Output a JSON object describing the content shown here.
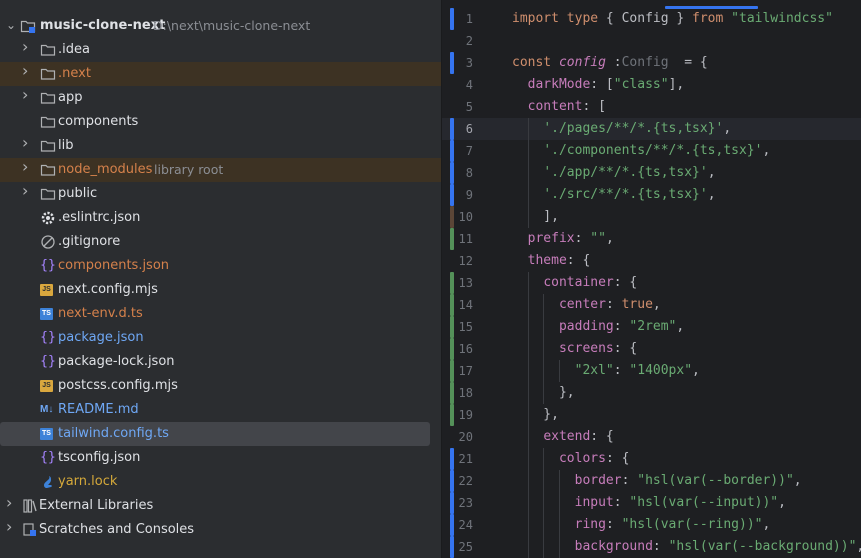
{
  "project_tree": {
    "root": {
      "name": "music-clone-next",
      "path": "D:\\next\\music-clone-next"
    },
    "items": [
      {
        "label": ".idea",
        "type": "folder",
        "expandable": true
      },
      {
        "label": ".next",
        "type": "folder",
        "expandable": true,
        "excluded": true
      },
      {
        "label": "app",
        "type": "folder",
        "expandable": true
      },
      {
        "label": "components",
        "type": "folder",
        "expandable": false
      },
      {
        "label": "lib",
        "type": "folder",
        "expandable": true
      },
      {
        "label": "node_modules",
        "type": "folder",
        "expandable": true,
        "excluded": true,
        "hint": "library root"
      },
      {
        "label": "public",
        "type": "folder",
        "expandable": true
      },
      {
        "label": ".eslintrc.json",
        "type": "eslint"
      },
      {
        "label": ".gitignore",
        "type": "ignore"
      },
      {
        "label": "components.json",
        "type": "json",
        "color": "#d5814b"
      },
      {
        "label": "next.config.mjs",
        "type": "js"
      },
      {
        "label": "next-env.d.ts",
        "type": "ts",
        "color": "#d5814b"
      },
      {
        "label": "package.json",
        "type": "json",
        "color": "#6fa8f5"
      },
      {
        "label": "package-lock.json",
        "type": "json"
      },
      {
        "label": "postcss.config.mjs",
        "type": "js"
      },
      {
        "label": "README.md",
        "type": "md",
        "color": "#6fa8f5"
      },
      {
        "label": "tailwind.config.ts",
        "type": "ts",
        "color": "#6fa8f5",
        "selected": true
      },
      {
        "label": "tsconfig.json",
        "type": "json"
      },
      {
        "label": "yarn.lock",
        "type": "yarn",
        "color": "#d5a93a"
      }
    ],
    "footer": [
      {
        "label": "External Libraries",
        "icon": "library-icon"
      },
      {
        "label": "Scratches and Consoles",
        "icon": "scratch-icon"
      }
    ]
  },
  "editor": {
    "file": "tailwind.config.ts",
    "current_line": 6,
    "lines": [
      {
        "n": "1",
        "mark": "blue",
        "code": "import type { Config } from \"tailwindcss\""
      },
      {
        "n": "2",
        "mark": "",
        "code": ""
      },
      {
        "n": "3",
        "mark": "blue",
        "code": "const config :  = {",
        "hint": "Config"
      },
      {
        "n": "4",
        "mark": "",
        "code": "  darkMode: [\"class\"],"
      },
      {
        "n": "5",
        "mark": "",
        "code": "  content: ["
      },
      {
        "n": "6",
        "mark": "blue",
        "code": "    './pages/**/*.{ts,tsx}',"
      },
      {
        "n": "7",
        "mark": "blue",
        "code": "    './components/**/*.{ts,tsx}',"
      },
      {
        "n": "8",
        "mark": "blue",
        "code": "    './app/**/*.{ts,tsx}',"
      },
      {
        "n": "9",
        "mark": "blue",
        "code": "    './src/**/*.{ts,tsx}',"
      },
      {
        "n": "10",
        "mark": "brown",
        "code": "    ],"
      },
      {
        "n": "11",
        "mark": "green",
        "code": "  prefix: \"\","
      },
      {
        "n": "12",
        "mark": "",
        "code": "  theme: {"
      },
      {
        "n": "13",
        "mark": "green",
        "code": "    container: {"
      },
      {
        "n": "14",
        "mark": "green",
        "code": "      center: true,"
      },
      {
        "n": "15",
        "mark": "green",
        "code": "      padding: \"2rem\","
      },
      {
        "n": "16",
        "mark": "green",
        "code": "      screens: {"
      },
      {
        "n": "17",
        "mark": "green",
        "code": "        \"2xl\": \"1400px\","
      },
      {
        "n": "18",
        "mark": "green",
        "code": "      },"
      },
      {
        "n": "19",
        "mark": "green",
        "code": "    },"
      },
      {
        "n": "20",
        "mark": "",
        "code": "    extend: {"
      },
      {
        "n": "21",
        "mark": "blue",
        "code": "      colors: {"
      },
      {
        "n": "22",
        "mark": "blue",
        "code": "        border: \"hsl(var(--border))\","
      },
      {
        "n": "23",
        "mark": "blue",
        "code": "        input: \"hsl(var(--input))\","
      },
      {
        "n": "24",
        "mark": "blue",
        "code": "        ring: \"hsl(var(--ring))\","
      },
      {
        "n": "25",
        "mark": "blue",
        "code": "        background: \"hsl(var(--background))\","
      }
    ]
  },
  "colors": {
    "keyword": "#cf8e6d",
    "string": "#6aab73",
    "property": "#c77dbb",
    "accent": "#3574f0",
    "modified": "#3574f0",
    "added": "#549159"
  }
}
